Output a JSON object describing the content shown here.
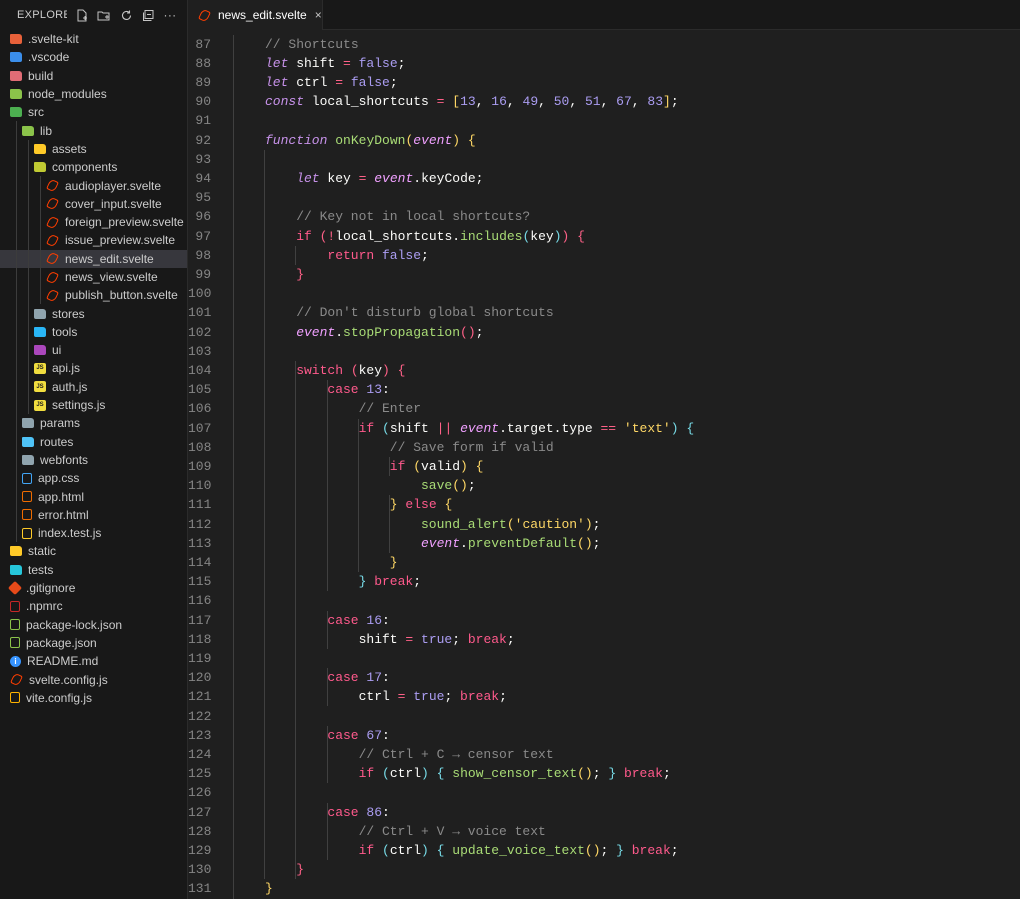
{
  "explorer": {
    "title": "EXPLORE...",
    "actions": [
      "new-file-icon",
      "new-folder-icon",
      "refresh-icon",
      "collapse-all-icon",
      "more-icon"
    ]
  },
  "tree": [
    {
      "label": ".svelte-kit",
      "kind": "folder",
      "color": "#e8613a",
      "depth": 0
    },
    {
      "label": ".vscode",
      "kind": "folder",
      "color": "#3b8eea",
      "depth": 0
    },
    {
      "label": "build",
      "kind": "folder",
      "color": "#e06c75",
      "depth": 0
    },
    {
      "label": "node_modules",
      "kind": "folder",
      "color": "#8bc34a",
      "depth": 0
    },
    {
      "label": "src",
      "kind": "folder",
      "color": "#4caf50",
      "depth": 0
    },
    {
      "label": "lib",
      "kind": "folder",
      "color": "#8bc34a",
      "depth": 1
    },
    {
      "label": "assets",
      "kind": "folder",
      "color": "#ffca28",
      "depth": 2
    },
    {
      "label": "components",
      "kind": "folder",
      "color": "#c0ca33",
      "depth": 2
    },
    {
      "label": "audioplayer.svelte",
      "kind": "svelte",
      "depth": 3
    },
    {
      "label": "cover_input.svelte",
      "kind": "svelte",
      "depth": 3
    },
    {
      "label": "foreign_preview.svelte",
      "kind": "svelte",
      "depth": 3
    },
    {
      "label": "issue_preview.svelte",
      "kind": "svelte",
      "depth": 3
    },
    {
      "label": "news_edit.svelte",
      "kind": "svelte",
      "depth": 3,
      "selected": true
    },
    {
      "label": "news_view.svelte",
      "kind": "svelte",
      "depth": 3
    },
    {
      "label": "publish_button.svelte",
      "kind": "svelte",
      "depth": 3
    },
    {
      "label": "stores",
      "kind": "folder",
      "color": "#90a4ae",
      "depth": 2
    },
    {
      "label": "tools",
      "kind": "folder",
      "color": "#29b6f6",
      "depth": 2
    },
    {
      "label": "ui",
      "kind": "folder",
      "color": "#ab47bc",
      "depth": 2
    },
    {
      "label": "api.js",
      "kind": "js",
      "depth": 2
    },
    {
      "label": "auth.js",
      "kind": "js",
      "depth": 2
    },
    {
      "label": "settings.js",
      "kind": "js",
      "depth": 2
    },
    {
      "label": "params",
      "kind": "folder",
      "color": "#90a4ae",
      "depth": 1
    },
    {
      "label": "routes",
      "kind": "folder",
      "color": "#4fc3f7",
      "depth": 1
    },
    {
      "label": "webfonts",
      "kind": "folder",
      "color": "#90a4ae",
      "depth": 1
    },
    {
      "label": "app.css",
      "kind": "file",
      "color": "#42a5f5",
      "depth": 1
    },
    {
      "label": "app.html",
      "kind": "file",
      "color": "#ef6c00",
      "depth": 1
    },
    {
      "label": "error.html",
      "kind": "file",
      "color": "#ef6c00",
      "depth": 1
    },
    {
      "label": "index.test.js",
      "kind": "file",
      "color": "#ffca28",
      "depth": 1
    },
    {
      "label": "static",
      "kind": "folder",
      "color": "#ffca28",
      "depth": 0
    },
    {
      "label": "tests",
      "kind": "folder",
      "color": "#26c6da",
      "depth": 0
    },
    {
      "label": ".gitignore",
      "kind": "git",
      "color": "#e64a19",
      "depth": 0
    },
    {
      "label": ".npmrc",
      "kind": "file",
      "color": "#c62828",
      "depth": 0
    },
    {
      "label": "package-lock.json",
      "kind": "file",
      "color": "#8bc34a",
      "depth": 0
    },
    {
      "label": "package.json",
      "kind": "file",
      "color": "#8bc34a",
      "depth": 0
    },
    {
      "label": "README.md",
      "kind": "info",
      "depth": 0
    },
    {
      "label": "svelte.config.js",
      "kind": "svelte",
      "depth": 0
    },
    {
      "label": "vite.config.js",
      "kind": "file",
      "color": "#ffb300",
      "depth": 0
    }
  ],
  "tab": {
    "label": "news_edit.svelte",
    "close": "×"
  },
  "colors": {
    "keyword": "#ff5a8c",
    "storage": "#c792ea",
    "function": "#a9dc76",
    "number": "#ab9df2",
    "comment": "#8a8a8a",
    "string": "#ffd866"
  },
  "code": [
    {
      "n": "87",
      "indent": 1,
      "t": [
        [
          "c",
          "// Shortcuts"
        ]
      ]
    },
    {
      "n": "88",
      "indent": 1,
      "t": [
        [
          "s",
          "let"
        ],
        [
          "id",
          " shift "
        ],
        [
          "op",
          "="
        ],
        [
          "n",
          " false"
        ],
        [
          "id",
          ";"
        ]
      ]
    },
    {
      "n": "89",
      "indent": 1,
      "t": [
        [
          "s",
          "let"
        ],
        [
          "id",
          " ctrl "
        ],
        [
          "op",
          "="
        ],
        [
          "n",
          " false"
        ],
        [
          "id",
          ";"
        ]
      ]
    },
    {
      "n": "90",
      "indent": 1,
      "t": [
        [
          "s",
          "const"
        ],
        [
          "id",
          " local_shortcuts "
        ],
        [
          "op",
          "="
        ],
        [
          "id",
          " "
        ],
        [
          "br",
          "["
        ],
        [
          "n",
          "13"
        ],
        [
          "id",
          ", "
        ],
        [
          "n",
          "16"
        ],
        [
          "id",
          ", "
        ],
        [
          "n",
          "49"
        ],
        [
          "id",
          ", "
        ],
        [
          "n",
          "50"
        ],
        [
          "id",
          ", "
        ],
        [
          "n",
          "51"
        ],
        [
          "id",
          ", "
        ],
        [
          "n",
          "67"
        ],
        [
          "id",
          ", "
        ],
        [
          "n",
          "83"
        ],
        [
          "br",
          "]"
        ],
        [
          "id",
          ";"
        ]
      ]
    },
    {
      "n": "91",
      "indent": 0,
      "t": []
    },
    {
      "n": "92",
      "indent": 1,
      "t": [
        [
          "s",
          "function"
        ],
        [
          "id",
          " "
        ],
        [
          "fn",
          "onKeyDown"
        ],
        [
          "br",
          "("
        ],
        [
          "v",
          "event"
        ],
        [
          "br",
          ")"
        ],
        [
          "id",
          " "
        ],
        [
          "br",
          "{"
        ]
      ]
    },
    {
      "n": "93",
      "indent": 0,
      "t": []
    },
    {
      "n": "94",
      "indent": 2,
      "t": [
        [
          "s",
          "let"
        ],
        [
          "id",
          " key "
        ],
        [
          "op",
          "="
        ],
        [
          "id",
          " "
        ],
        [
          "v",
          "event"
        ],
        [
          "id",
          "."
        ],
        [
          "id",
          "keyCode;"
        ]
      ]
    },
    {
      "n": "95",
      "indent": 0,
      "t": []
    },
    {
      "n": "96",
      "indent": 2,
      "t": [
        [
          "c",
          "// Key not in local shortcuts?"
        ]
      ]
    },
    {
      "n": "97",
      "indent": 2,
      "t": [
        [
          "k",
          "if"
        ],
        [
          "id",
          " "
        ],
        [
          "p",
          "("
        ],
        [
          "op",
          "!"
        ],
        [
          "id",
          "local_shortcuts."
        ],
        [
          "fn",
          "includes"
        ],
        [
          "fa",
          "("
        ],
        [
          "id",
          "key"
        ],
        [
          "fa",
          ")"
        ],
        [
          "p",
          ")"
        ],
        [
          "id",
          " "
        ],
        [
          "p",
          "{"
        ]
      ]
    },
    {
      "n": "98",
      "indent": 3,
      "t": [
        [
          "k",
          "return"
        ],
        [
          "n",
          " false"
        ],
        [
          "id",
          ";"
        ]
      ]
    },
    {
      "n": "99",
      "indent": 2,
      "t": [
        [
          "p",
          "}"
        ]
      ]
    },
    {
      "n": "100",
      "indent": 0,
      "t": []
    },
    {
      "n": "101",
      "indent": 2,
      "t": [
        [
          "c",
          "// Don't disturb global shortcuts"
        ]
      ]
    },
    {
      "n": "102",
      "indent": 2,
      "t": [
        [
          "v",
          "event"
        ],
        [
          "id",
          "."
        ],
        [
          "fn",
          "stopPropagation"
        ],
        [
          "p",
          "()"
        ],
        [
          "id",
          ";"
        ]
      ]
    },
    {
      "n": "103",
      "indent": 0,
      "t": []
    },
    {
      "n": "104",
      "indent": 2,
      "t": [
        [
          "k",
          "switch"
        ],
        [
          "id",
          " "
        ],
        [
          "p",
          "("
        ],
        [
          "id",
          "key"
        ],
        [
          "p",
          ")"
        ],
        [
          "id",
          " "
        ],
        [
          "p",
          "{"
        ]
      ]
    },
    {
      "n": "105",
      "indent": 3,
      "t": [
        [
          "k",
          "case"
        ],
        [
          "n",
          " 13"
        ],
        [
          "id",
          ":"
        ]
      ]
    },
    {
      "n": "106",
      "indent": 4,
      "t": [
        [
          "c",
          "// Enter"
        ]
      ]
    },
    {
      "n": "107",
      "indent": 4,
      "t": [
        [
          "k",
          "if"
        ],
        [
          "id",
          " "
        ],
        [
          "fa",
          "("
        ],
        [
          "id",
          "shift "
        ],
        [
          "op",
          "||"
        ],
        [
          "id",
          " "
        ],
        [
          "v",
          "event"
        ],
        [
          "id",
          ".target.type "
        ],
        [
          "op",
          "=="
        ],
        [
          "id",
          " "
        ],
        [
          "str",
          "'text'"
        ],
        [
          "fa",
          ")"
        ],
        [
          "id",
          " "
        ],
        [
          "fa",
          "{"
        ]
      ]
    },
    {
      "n": "108",
      "indent": 5,
      "t": [
        [
          "c",
          "// Save form if valid"
        ]
      ]
    },
    {
      "n": "109",
      "indent": 5,
      "t": [
        [
          "k",
          "if"
        ],
        [
          "id",
          " "
        ],
        [
          "br",
          "("
        ],
        [
          "id",
          "valid"
        ],
        [
          "br",
          ")"
        ],
        [
          "id",
          " "
        ],
        [
          "br",
          "{"
        ]
      ]
    },
    {
      "n": "110",
      "indent": 6,
      "t": [
        [
          "fn",
          "save"
        ],
        [
          "br",
          "()"
        ],
        [
          "id",
          ";"
        ]
      ]
    },
    {
      "n": "111",
      "indent": 5,
      "t": [
        [
          "br",
          "}"
        ],
        [
          "k",
          " else"
        ],
        [
          "id",
          " "
        ],
        [
          "br",
          "{"
        ]
      ]
    },
    {
      "n": "112",
      "indent": 6,
      "t": [
        [
          "fn",
          "sound_alert"
        ],
        [
          "br",
          "("
        ],
        [
          "str",
          "'caution'"
        ],
        [
          "br",
          ")"
        ],
        [
          "id",
          ";"
        ]
      ]
    },
    {
      "n": "113",
      "indent": 6,
      "t": [
        [
          "v",
          "event"
        ],
        [
          "id",
          "."
        ],
        [
          "fn",
          "preventDefault"
        ],
        [
          "br",
          "()"
        ],
        [
          "id",
          ";"
        ]
      ]
    },
    {
      "n": "114",
      "indent": 5,
      "t": [
        [
          "br",
          "}"
        ]
      ]
    },
    {
      "n": "115",
      "indent": 4,
      "t": [
        [
          "fa",
          "}"
        ],
        [
          "k",
          " break"
        ],
        [
          "id",
          ";"
        ]
      ]
    },
    {
      "n": "116",
      "indent": 0,
      "t": []
    },
    {
      "n": "117",
      "indent": 3,
      "t": [
        [
          "k",
          "case"
        ],
        [
          "n",
          " 16"
        ],
        [
          "id",
          ":"
        ]
      ]
    },
    {
      "n": "118",
      "indent": 4,
      "t": [
        [
          "id",
          "shift "
        ],
        [
          "op",
          "="
        ],
        [
          "n",
          " true"
        ],
        [
          "id",
          ";"
        ],
        [
          "k",
          " break"
        ],
        [
          "id",
          ";"
        ]
      ]
    },
    {
      "n": "119",
      "indent": 0,
      "t": []
    },
    {
      "n": "120",
      "indent": 3,
      "t": [
        [
          "k",
          "case"
        ],
        [
          "n",
          " 17"
        ],
        [
          "id",
          ":"
        ]
      ]
    },
    {
      "n": "121",
      "indent": 4,
      "t": [
        [
          "id",
          "ctrl "
        ],
        [
          "op",
          "="
        ],
        [
          "n",
          " true"
        ],
        [
          "id",
          ";"
        ],
        [
          "k",
          " break"
        ],
        [
          "id",
          ";"
        ]
      ]
    },
    {
      "n": "122",
      "indent": 0,
      "t": []
    },
    {
      "n": "123",
      "indent": 3,
      "t": [
        [
          "k",
          "case"
        ],
        [
          "n",
          " 67"
        ],
        [
          "id",
          ":"
        ]
      ]
    },
    {
      "n": "124",
      "indent": 4,
      "t": [
        [
          "c",
          "// Ctrl + C → censor text"
        ]
      ]
    },
    {
      "n": "125",
      "indent": 4,
      "t": [
        [
          "k",
          "if"
        ],
        [
          "id",
          " "
        ],
        [
          "fa",
          "("
        ],
        [
          "id",
          "ctrl"
        ],
        [
          "fa",
          ")"
        ],
        [
          "id",
          " "
        ],
        [
          "fa",
          "{"
        ],
        [
          "id",
          " "
        ],
        [
          "fn",
          "show_censor_text"
        ],
        [
          "br",
          "()"
        ],
        [
          "id",
          "; "
        ],
        [
          "fa",
          "}"
        ],
        [
          "k",
          " break"
        ],
        [
          "id",
          ";"
        ]
      ]
    },
    {
      "n": "126",
      "indent": 0,
      "t": []
    },
    {
      "n": "127",
      "indent": 3,
      "t": [
        [
          "k",
          "case"
        ],
        [
          "n",
          " 86"
        ],
        [
          "id",
          ":"
        ]
      ]
    },
    {
      "n": "128",
      "indent": 4,
      "t": [
        [
          "c",
          "// Ctrl + V → voice text"
        ]
      ]
    },
    {
      "n": "129",
      "indent": 4,
      "t": [
        [
          "k",
          "if"
        ],
        [
          "id",
          " "
        ],
        [
          "fa",
          "("
        ],
        [
          "id",
          "ctrl"
        ],
        [
          "fa",
          ")"
        ],
        [
          "id",
          " "
        ],
        [
          "fa",
          "{"
        ],
        [
          "id",
          " "
        ],
        [
          "fn",
          "update_voice_text"
        ],
        [
          "br",
          "()"
        ],
        [
          "id",
          "; "
        ],
        [
          "fa",
          "}"
        ],
        [
          "k",
          " break"
        ],
        [
          "id",
          ";"
        ]
      ]
    },
    {
      "n": "130",
      "indent": 2,
      "t": [
        [
          "p",
          "}"
        ]
      ]
    },
    {
      "n": "131",
      "indent": 1,
      "t": [
        [
          "br",
          "}"
        ]
      ]
    }
  ]
}
